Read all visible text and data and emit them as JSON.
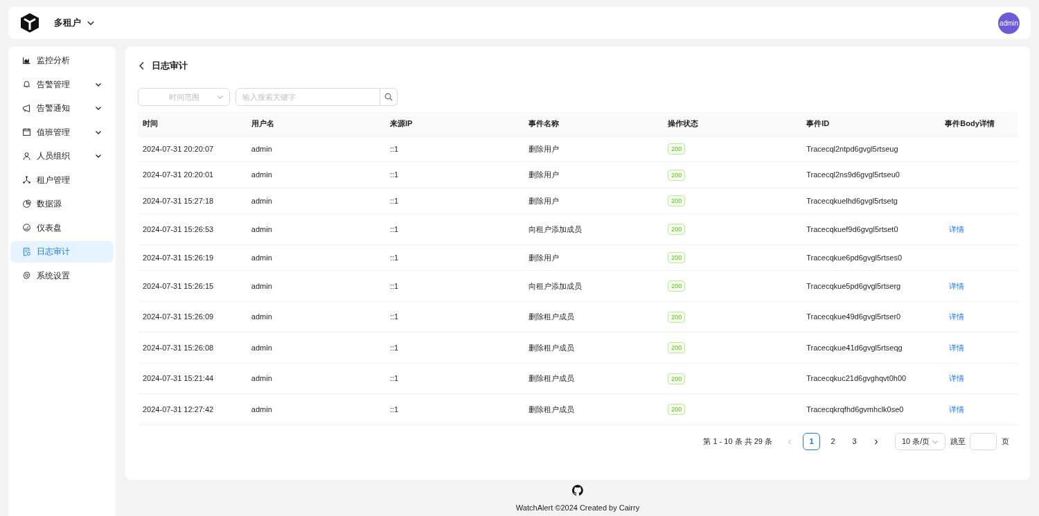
{
  "header": {
    "tenant": "多租户",
    "avatar": "admin"
  },
  "sidebar": {
    "items": [
      {
        "label": "监控分析",
        "expandable": false,
        "selected": false
      },
      {
        "label": "告警管理",
        "expandable": true,
        "selected": false
      },
      {
        "label": "告警通知",
        "expandable": true,
        "selected": false
      },
      {
        "label": "值班管理",
        "expandable": true,
        "selected": false
      },
      {
        "label": "人员组织",
        "expandable": true,
        "selected": false
      },
      {
        "label": "租户管理",
        "expandable": false,
        "selected": false
      },
      {
        "label": "数据源",
        "expandable": false,
        "selected": false
      },
      {
        "label": "仪表盘",
        "expandable": false,
        "selected": false
      },
      {
        "label": "日志审计",
        "expandable": false,
        "selected": true
      },
      {
        "label": "系统设置",
        "expandable": false,
        "selected": false
      }
    ]
  },
  "page": {
    "title": "日志审计",
    "time_range": {
      "placeholder": "时间范围"
    },
    "search": {
      "placeholder": "输入搜索关键字"
    }
  },
  "table": {
    "columns": [
      "时间",
      "用户名",
      "来源IP",
      "事件名称",
      "操作状态",
      "事件ID",
      "事件Body详情"
    ],
    "rows": [
      {
        "time": "2024-07-31 20:20:07",
        "user": "admin",
        "ip": "::1",
        "event": "删除用户",
        "status": "200",
        "id": "Tracecql2ntpd6gvgl5rtseug"
      },
      {
        "time": "2024-07-31 20:20:01",
        "user": "admin",
        "ip": "::1",
        "event": "删除用户",
        "status": "200",
        "id": "Tracecql2ns9d6gvgl5rtseu0"
      },
      {
        "time": "2024-07-31 15:27:18",
        "user": "admin",
        "ip": "::1",
        "event": "删除用户",
        "status": "200",
        "id": "Tracecqkuelhd6gvgl5rtsetg"
      },
      {
        "time": "2024-07-31 15:26:53",
        "user": "admin",
        "ip": "::1",
        "event": "向租户添加成员",
        "status": "200",
        "id": "Tracecqkuef9d6gvgl5rtset0",
        "detail": "详情"
      },
      {
        "time": "2024-07-31 15:26:19",
        "user": "admin",
        "ip": "::1",
        "event": "删除用户",
        "status": "200",
        "id": "Tracecqkue6pd6gvgl5rtses0"
      },
      {
        "time": "2024-07-31 15:26:15",
        "user": "admin",
        "ip": "::1",
        "event": "向租户添加成员",
        "status": "200",
        "id": "Tracecqkue5pd6gvgl5rtserg",
        "detail": "详情"
      },
      {
        "time": "2024-07-31 15:26:09",
        "user": "admin",
        "ip": "::1",
        "event": "删除租户成员",
        "status": "200",
        "id": "Tracecqkue49d6gvgl5rtser0",
        "detail": "详情"
      },
      {
        "time": "2024-07-31 15:26:08",
        "user": "admin",
        "ip": "::1",
        "event": "删除租户成员",
        "status": "200",
        "id": "Tracecqkue41d6gvgl5rtseqg",
        "detail": "详情"
      },
      {
        "time": "2024-07-31 15:21:44",
        "user": "admin",
        "ip": "::1",
        "event": "删除租户成员",
        "status": "200",
        "id": "Tracecqkuc21d6gvghqvt0h00",
        "detail": "详情"
      },
      {
        "time": "2024-07-31 12:27:42",
        "user": "admin",
        "ip": "::1",
        "event": "删除租户成员",
        "status": "200",
        "id": "Tracecqkrqfhd6gvmhclk0se0",
        "detail": "详情"
      }
    ]
  },
  "pagination": {
    "summary": "第 1 - 10 条 共 29 条",
    "pages": [
      {
        "label": "1",
        "selected": true
      },
      {
        "label": "2",
        "selected": false
      },
      {
        "label": "3",
        "selected": false
      }
    ],
    "page_size": "10 条/页",
    "jump_label": "跳至",
    "page_suffix": "页"
  },
  "footer": {
    "text": "WatchAlert ©2024 Created by Cairry"
  }
}
